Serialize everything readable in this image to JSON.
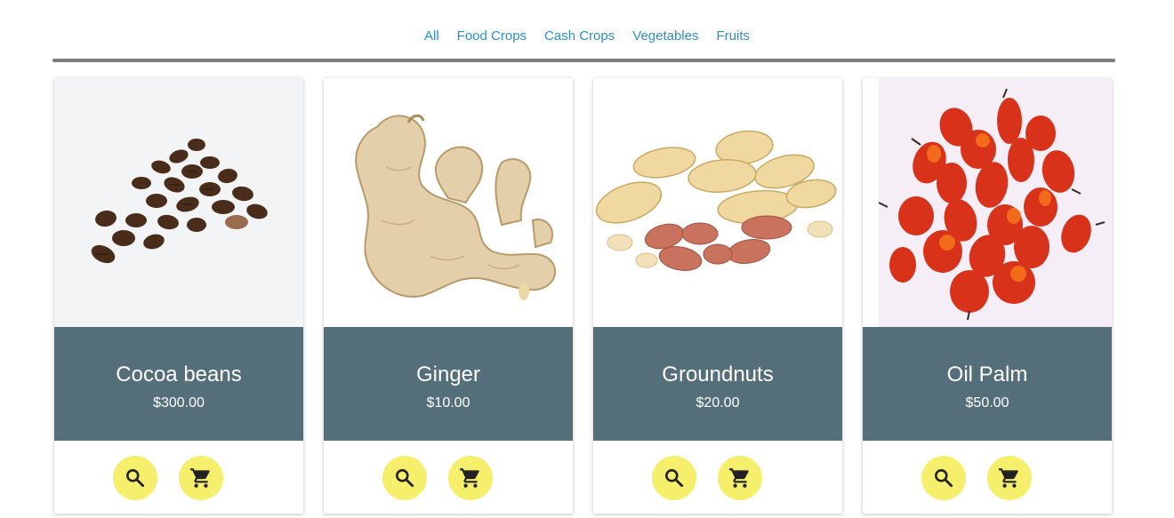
{
  "filters": [
    {
      "label": "All"
    },
    {
      "label": "Food Crops"
    },
    {
      "label": "Cash Crops"
    },
    {
      "label": "Vegetables"
    },
    {
      "label": "Fruits"
    }
  ],
  "products": [
    {
      "title": "Cocoa beans",
      "price": "$300.00",
      "image_icon": "cocoa-beans-image"
    },
    {
      "title": "Ginger",
      "price": "$10.00",
      "image_icon": "ginger-image"
    },
    {
      "title": "Groundnuts",
      "price": "$20.00",
      "image_icon": "groundnuts-image"
    },
    {
      "title": "Oil Palm",
      "price": "$50.00",
      "image_icon": "oil-palm-image"
    }
  ],
  "colors": {
    "link": "#2b8fca",
    "divider": "#7d7d7d",
    "card_info_bg": "#546e7a",
    "fab_bg": "#f5ef6b"
  },
  "icons": {
    "search": "search-icon",
    "cart": "shopping-cart-icon"
  }
}
